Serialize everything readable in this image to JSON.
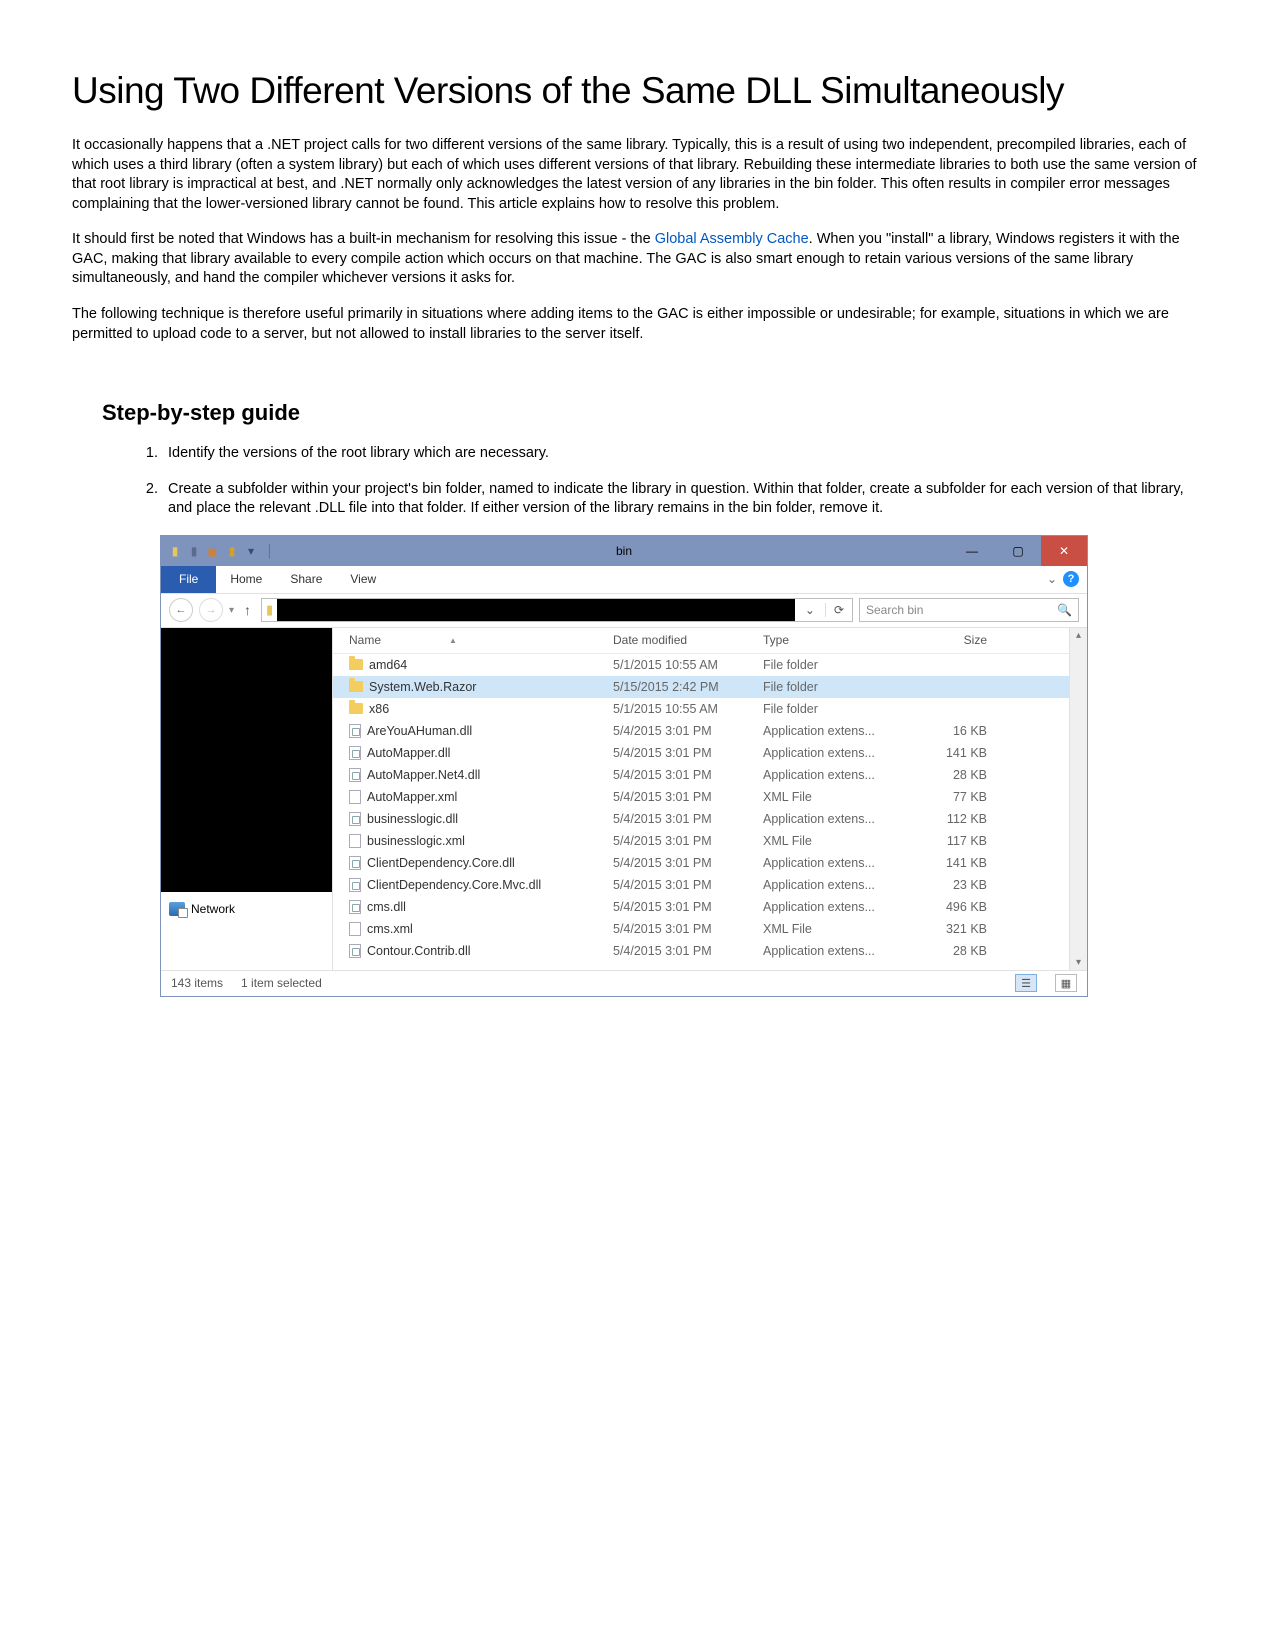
{
  "title": "Using Two Different Versions of the Same DLL Simultaneously",
  "para1": "It occasionally happens that a .NET project calls for two different versions of the same library. Typically, this is a result of using two independent, precompiled libraries, each of which uses a third library (often a system library) but each of which uses different versions of that library. Rebuilding these intermediate libraries to both use the same version of that root library is impractical at best, and .NET normally only acknowledges the latest version of any libraries in the bin folder. This often results in compiler error messages complaining that the lower-versioned library cannot be found. This article explains how to resolve this problem.",
  "para2_pre": "It should first be noted that Windows has a built-in mechanism for resolving this issue - the ",
  "para2_link": "Global Assembly Cache",
  "para2_post": ". When you \"install\" a library, Windows registers it with the GAC, making that library available to every compile action which occurs on that machine. The GAC is also smart enough to retain various versions of the same library simultaneously, and hand the compiler whichever versions it asks for.",
  "para3": "The following technique is therefore useful primarily in situations where adding items to the GAC is either impossible or undesirable; for example, situations in which we are permitted to upload code to a server, but not allowed to install libraries to the server itself.",
  "guide_heading": "Step-by-step guide",
  "steps": {
    "s1": "Identify the versions of the root library which are necessary.",
    "s2": "Create a subfolder within your project's bin folder, named to indicate the library in question. Within that folder, create a subfolder for each version of that library, and place the relevant .DLL file into that folder. If either version of the library remains in the bin folder, remove it."
  },
  "explorer": {
    "window_title": "bin",
    "ribbon": {
      "file": "File",
      "home": "Home",
      "share": "Share",
      "view": "View"
    },
    "search_placeholder": "Search bin",
    "columns": {
      "name": "Name",
      "date": "Date modified",
      "type": "Type",
      "size": "Size"
    },
    "nav": {
      "network": "Network"
    },
    "status": {
      "count": "143 items",
      "selected": "1 item selected"
    },
    "files": [
      {
        "icon": "folder",
        "name": "amd64",
        "date": "5/1/2015 10:55 AM",
        "type": "File folder",
        "size": "",
        "selected": false
      },
      {
        "icon": "folder",
        "name": "System.Web.Razor",
        "date": "5/15/2015 2:42 PM",
        "type": "File folder",
        "size": "",
        "selected": true
      },
      {
        "icon": "folder",
        "name": "x86",
        "date": "5/1/2015 10:55 AM",
        "type": "File folder",
        "size": "",
        "selected": false
      },
      {
        "icon": "dll",
        "name": "AreYouAHuman.dll",
        "date": "5/4/2015 3:01 PM",
        "type": "Application extens...",
        "size": "16 KB",
        "selected": false
      },
      {
        "icon": "dll",
        "name": "AutoMapper.dll",
        "date": "5/4/2015 3:01 PM",
        "type": "Application extens...",
        "size": "141 KB",
        "selected": false
      },
      {
        "icon": "dll",
        "name": "AutoMapper.Net4.dll",
        "date": "5/4/2015 3:01 PM",
        "type": "Application extens...",
        "size": "28 KB",
        "selected": false
      },
      {
        "icon": "file",
        "name": "AutoMapper.xml",
        "date": "5/4/2015 3:01 PM",
        "type": "XML File",
        "size": "77 KB",
        "selected": false
      },
      {
        "icon": "dll",
        "name": "businesslogic.dll",
        "date": "5/4/2015 3:01 PM",
        "type": "Application extens...",
        "size": "112 KB",
        "selected": false
      },
      {
        "icon": "file",
        "name": "businesslogic.xml",
        "date": "5/4/2015 3:01 PM",
        "type": "XML File",
        "size": "117 KB",
        "selected": false
      },
      {
        "icon": "dll",
        "name": "ClientDependency.Core.dll",
        "date": "5/4/2015 3:01 PM",
        "type": "Application extens...",
        "size": "141 KB",
        "selected": false
      },
      {
        "icon": "dll",
        "name": "ClientDependency.Core.Mvc.dll",
        "date": "5/4/2015 3:01 PM",
        "type": "Application extens...",
        "size": "23 KB",
        "selected": false
      },
      {
        "icon": "dll",
        "name": "cms.dll",
        "date": "5/4/2015 3:01 PM",
        "type": "Application extens...",
        "size": "496 KB",
        "selected": false
      },
      {
        "icon": "file",
        "name": "cms.xml",
        "date": "5/4/2015 3:01 PM",
        "type": "XML File",
        "size": "321 KB",
        "selected": false
      },
      {
        "icon": "dll",
        "name": "Contour.Contrib.dll",
        "date": "5/4/2015 3:01 PM",
        "type": "Application extens...",
        "size": "28 KB",
        "selected": false
      }
    ]
  }
}
